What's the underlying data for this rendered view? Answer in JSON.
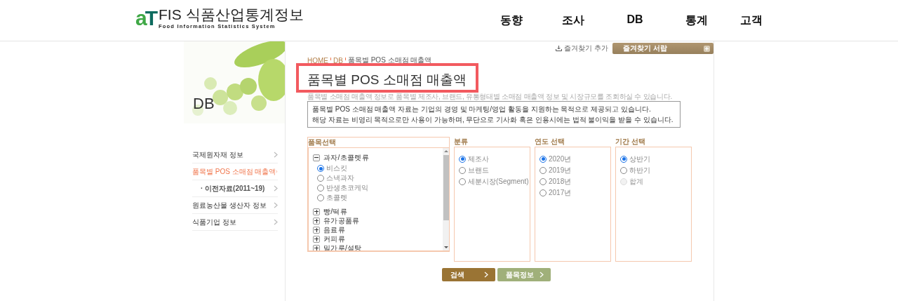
{
  "header": {
    "logo": {
      "mark_a": "a",
      "mark_t": "T",
      "title": "FIS 식품산업통계정보",
      "subtitle": "Food Information Statistics System"
    },
    "nav": [
      {
        "label": "동향"
      },
      {
        "label": "조사"
      },
      {
        "label": "DB"
      },
      {
        "label": "통계"
      },
      {
        "label": "고객"
      }
    ]
  },
  "sidebar": {
    "banner_title": "DB",
    "items": [
      {
        "label": "국제원자재 정보",
        "selected": false
      },
      {
        "label": "품목별 POS 소매점 매출액",
        "selected": true,
        "children": [
          {
            "label": "· 이전자료(2011~19)",
            "selected": false
          }
        ]
      },
      {
        "label": "원료농산물 생산자 정보",
        "selected": false
      },
      {
        "label": "식품기업 정보",
        "selected": false
      }
    ]
  },
  "bookmark": {
    "add": "즐겨찾기 추가",
    "drawer": "즐겨찾기 서랍"
  },
  "breadcrumb": [
    "HOME",
    "DB",
    "품목별 POS 소매점 매출액"
  ],
  "page_title": {
    "text": "품목별 POS 소매점 매출액",
    "highlighted": true
  },
  "description": "품목별 소매점 매출액 정보로 품목별 제조사, 브랜드, 유통형태별 소매점 매출액 정보 및 시장규모를 조회하실 수 있습니다.",
  "notice": [
    "품목별 POS 소매점 매출액 자료는 기업의 경영 및 마케팅/영업 활동을 지원하는 목적으로 제공되고 있습니다.",
    "해당 자료는 비영리 목적으로만 사용이 가능하며, 무단으로 기사화 혹은 인용시에는 법적 불이익을 받을 수 있습니다."
  ],
  "panels": [
    {
      "kind": "tree",
      "title": "품목선택",
      "groups": [
        {
          "label": "과자/초콜렛류",
          "expanded": true,
          "children": [
            {
              "label": "비스킷",
              "selected": true
            },
            {
              "label": "스낵과자",
              "selected": false
            },
            {
              "label": "반생초코케익",
              "selected": false
            },
            {
              "label": "초콜렛",
              "selected": false
            }
          ]
        },
        {
          "label": "빵/떡류",
          "expanded": false
        },
        {
          "label": "유가공품류",
          "expanded": false
        },
        {
          "label": "음료류",
          "expanded": false
        },
        {
          "label": "커피류",
          "expanded": false
        },
        {
          "label": "밀가루/설탕",
          "expanded": false
        }
      ]
    },
    {
      "kind": "radio",
      "title": "분류",
      "options": [
        {
          "label": "제조사",
          "selected": true,
          "disabled": false
        },
        {
          "label": "브랜드",
          "selected": false,
          "disabled": false
        },
        {
          "label": "세분시장(Segment)",
          "selected": false,
          "disabled": false
        }
      ]
    },
    {
      "kind": "radio",
      "title": "연도 선택",
      "options": [
        {
          "label": "2020년",
          "selected": true,
          "disabled": false
        },
        {
          "label": "2019년",
          "selected": false,
          "disabled": false
        },
        {
          "label": "2018년",
          "selected": false,
          "disabled": false
        },
        {
          "label": "2017년",
          "selected": false,
          "disabled": false
        }
      ]
    },
    {
      "kind": "radio",
      "title": "기간 선택",
      "options": [
        {
          "label": "상반기",
          "selected": true,
          "disabled": false
        },
        {
          "label": "하반기",
          "selected": false,
          "disabled": false
        },
        {
          "label": "합계",
          "selected": false,
          "disabled": true
        }
      ]
    }
  ],
  "buttons": [
    {
      "label": "검색",
      "kind": "primary"
    },
    {
      "label": "품목정보",
      "kind": "secondary"
    }
  ]
}
